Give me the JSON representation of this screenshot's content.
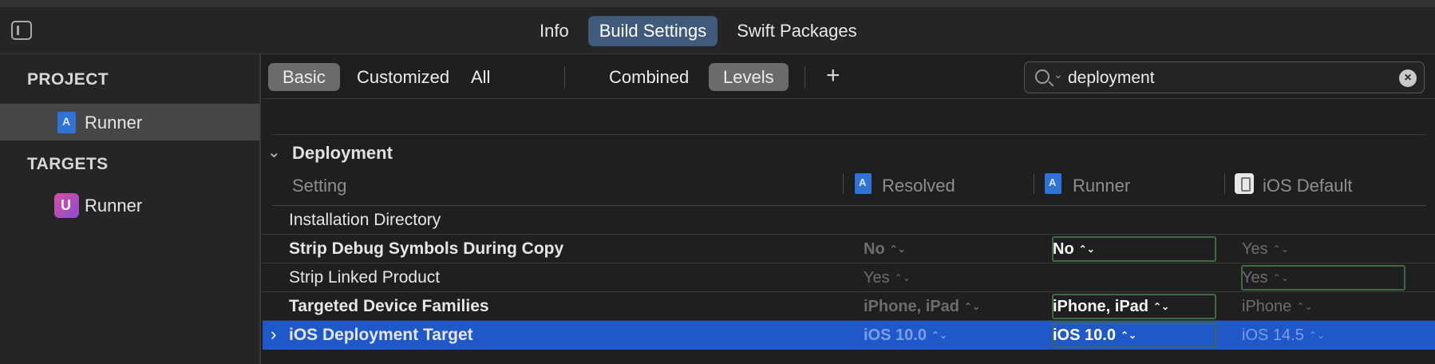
{
  "top_tabs": [
    "Info",
    "Build Settings",
    "Swift Packages"
  ],
  "sidebar": {
    "project_header": "PROJECT",
    "project_item": "Runner",
    "targets_header": "TARGETS",
    "target_item": "Runner"
  },
  "filters": {
    "basic": "Basic",
    "customized": "Customized",
    "all": "All",
    "combined": "Combined",
    "levels": "Levels",
    "add": "+"
  },
  "search": {
    "value": "deployment"
  },
  "section": {
    "title": "Deployment"
  },
  "columns": {
    "setting": "Setting",
    "resolved": "Resolved",
    "runner": "Runner",
    "ios_default": "iOS Default"
  },
  "rows": [
    {
      "name": "Installation Directory",
      "resolved": "",
      "runner": "",
      "default": ""
    },
    {
      "name": "Strip Debug Symbols During Copy",
      "resolved": "No",
      "runner": "No",
      "default": "Yes"
    },
    {
      "name": "Strip Linked Product",
      "resolved": "Yes",
      "runner": "",
      "default": "Yes"
    },
    {
      "name": "Targeted Device Families",
      "resolved": "iPhone, iPad",
      "runner": "iPhone, iPad",
      "default": "iPhone"
    },
    {
      "name": "iOS Deployment Target",
      "resolved": "iOS 10.0",
      "runner": "iOS 10.0",
      "default": "iOS 14.5"
    }
  ],
  "stepper_glyph": "⌃⌄",
  "colors": {
    "selected_row": "#1f58c9",
    "active_tab": "#3f5a7b",
    "highlight_box": "#3f6a44"
  }
}
